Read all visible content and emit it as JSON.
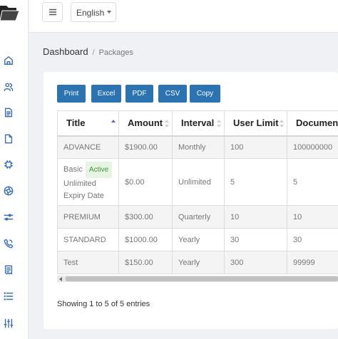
{
  "header": {
    "language": "English"
  },
  "sidebar": {
    "icons": [
      "home-icon",
      "users-icon",
      "document-icon",
      "file-icon",
      "chip-icon",
      "aperture-icon",
      "sliders-icon",
      "phone-icon",
      "receipt-icon",
      "list-icon",
      "settings-sliders-icon"
    ]
  },
  "breadcrumb": {
    "root": "Dashboard",
    "separator": "/",
    "current": "Packages"
  },
  "export_buttons": [
    "Print",
    "Excel",
    "PDF",
    "CSV",
    "Copy"
  ],
  "table": {
    "columns": [
      "Title",
      "Amount",
      "Interval",
      "User Limit",
      "Documen"
    ],
    "rows": [
      {
        "title": "ADVANCE",
        "badge": "",
        "title_extra": "",
        "amount": "$1900.00",
        "interval": "Monthly",
        "user_limit": "100",
        "documents": "100000000"
      },
      {
        "title": "Basic",
        "badge": "Active",
        "title_extra": "Unlimited Expiry Date",
        "amount": "$0.00",
        "interval": "Unlimited",
        "user_limit": "5",
        "documents": "5"
      },
      {
        "title": "PREMIUM",
        "badge": "",
        "title_extra": "",
        "amount": "$300.00",
        "interval": "Quarterly",
        "user_limit": "10",
        "documents": "10"
      },
      {
        "title": "STANDARD",
        "badge": "",
        "title_extra": "",
        "amount": "$1000.00",
        "interval": "Yearly",
        "user_limit": "30",
        "documents": "30"
      },
      {
        "title": "Test",
        "badge": "",
        "title_extra": "",
        "amount": "$150.00",
        "interval": "Yearly",
        "user_limit": "300",
        "documents": "99999"
      }
    ]
  },
  "footer": {
    "info": "Showing 1 to 5 of 5 entries"
  },
  "colors": {
    "accent": "#2b74b1",
    "sidebar_icon": "#3a6fb5",
    "badge_bg": "#e7f4e4",
    "badge_text": "#3b9a3b"
  }
}
